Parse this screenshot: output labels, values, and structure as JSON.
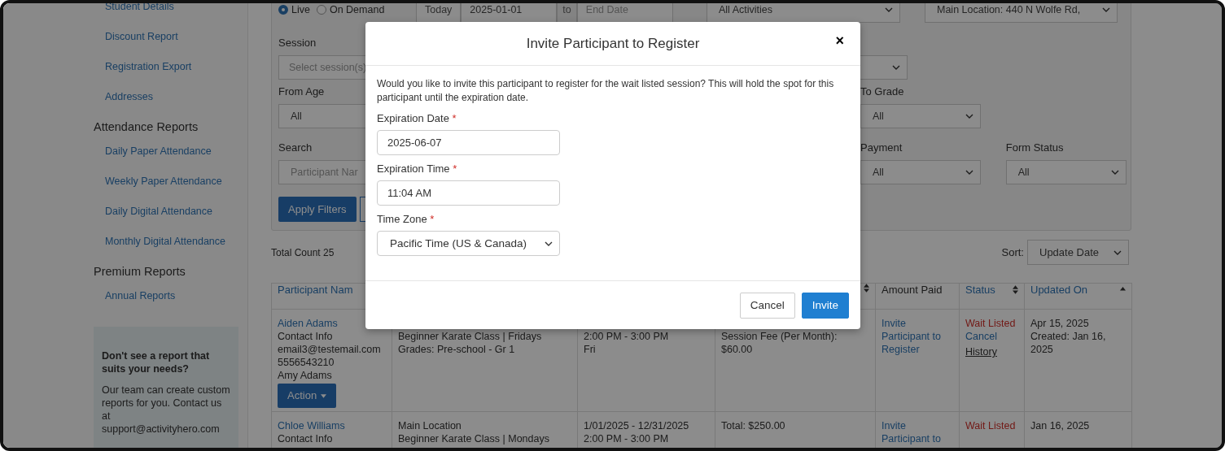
{
  "sidebar": {
    "items": [
      {
        "kind": "link",
        "label": "Student Details"
      },
      {
        "kind": "link",
        "label": "Discount Report"
      },
      {
        "kind": "link",
        "label": "Registration Export"
      },
      {
        "kind": "link",
        "label": "Addresses"
      },
      {
        "kind": "heading",
        "label": "Attendance Reports"
      },
      {
        "kind": "link",
        "label": "Daily Paper Attendance"
      },
      {
        "kind": "link",
        "label": "Weekly Paper Attendance"
      },
      {
        "kind": "link",
        "label": "Daily Digital Attendance"
      },
      {
        "kind": "link",
        "label": "Monthly Digital Attendance"
      },
      {
        "kind": "heading",
        "label": "Premium Reports"
      },
      {
        "kind": "link",
        "label": "Annual Reports"
      }
    ],
    "promo": {
      "title": "Don't see a report that suits your needs?",
      "text": "Our team can create custom reports for you. Contact us at support@activityhero.com"
    }
  },
  "filters": {
    "mode_options": [
      {
        "label": "Live",
        "selected": true
      },
      {
        "label": "On Demand",
        "selected": false
      }
    ],
    "date_range": {
      "preset": "Today",
      "start": "2025-01-01",
      "separator": "to",
      "end_placeholder": "End Date"
    },
    "activity": "All Activities",
    "location": "Main Location: 440 N Wolfe Rd,",
    "session": {
      "label": "Session",
      "placeholder": "Select session(s)"
    },
    "from_age": {
      "label": "From Age",
      "value": "All"
    },
    "to_grade": {
      "label": "To Grade",
      "value": "All"
    },
    "search": {
      "label": "Search",
      "placeholder": "Participant Nar"
    },
    "payment": {
      "label": "Payment",
      "value": "All"
    },
    "form_status": {
      "label": "Form Status",
      "value": "All"
    },
    "apply_button": "Apply Filters"
  },
  "total_count": "Total Count 25",
  "sort": {
    "label": "Sort:",
    "value": "Update Date"
  },
  "table": {
    "columns": [
      {
        "label": "Participant Nam"
      },
      {},
      {},
      {
        "sortable": true
      },
      {
        "label": "Amount Paid",
        "sortable": false
      },
      {
        "label": "Status",
        "sortable": true
      },
      {
        "label": "Updated On",
        "sorted": true
      }
    ],
    "rows": [
      {
        "cells": [
          {
            "parts": [
              {
                "kind": "link",
                "text": "Aiden Adams"
              },
              {
                "kind": "text",
                "text": "Contact Info"
              },
              {
                "kind": "text",
                "text": "email3@testemail.com"
              },
              {
                "kind": "text",
                "text": "5556543210"
              },
              {
                "kind": "text",
                "text": "Amy Adams"
              },
              {
                "kind": "button",
                "text": "Action"
              }
            ]
          },
          {
            "first_line_hidden": true,
            "parts": [
              {
                "kind": "text",
                "text": "Beginner Karate Class | Fridays"
              },
              {
                "kind": "text",
                "text": "Grades: Pre-school - Gr 1"
              }
            ]
          },
          {
            "first_line_hidden": true,
            "parts": [
              {
                "kind": "text",
                "text": "2:00 PM - 3:00 PM"
              },
              {
                "kind": "text",
                "text": "Fri"
              }
            ]
          },
          {
            "first_line_hidden": true,
            "parts": [
              {
                "kind": "text",
                "text": "Session Fee (Per Month):"
              },
              {
                "kind": "text",
                "text": "$60.00"
              }
            ]
          },
          {
            "parts": [
              {
                "kind": "link",
                "text": "Invite Participant to Register"
              }
            ]
          },
          {
            "parts": [
              {
                "kind": "alert",
                "text": "Wait Listed"
              },
              {
                "kind": "link",
                "text": "Cancel"
              },
              {
                "kind": "underline",
                "text": "History"
              }
            ]
          },
          {
            "parts": [
              {
                "kind": "text",
                "text": "Apr 15, 2025"
              },
              {
                "kind": "text",
                "text": "Created: Jan 16, 2025"
              }
            ]
          }
        ]
      },
      {
        "cells": [
          {
            "parts": [
              {
                "kind": "link",
                "text": "Chloe Williams"
              },
              {
                "kind": "text",
                "text": "Contact Info"
              }
            ]
          },
          {
            "parts": [
              {
                "kind": "text",
                "text": "Main Location"
              },
              {
                "kind": "text",
                "text": "Beginner Karate Class | Mondays"
              }
            ]
          },
          {
            "parts": [
              {
                "kind": "text",
                "text": "1/01/2025 - 12/31/2025"
              },
              {
                "kind": "text",
                "text": "2:00 PM - 3:00 PM"
              }
            ]
          },
          {
            "parts": [
              {
                "kind": "text",
                "text": "Total: $250.00"
              }
            ]
          },
          {
            "parts": [
              {
                "kind": "link",
                "text": "Invite Participant to"
              }
            ]
          },
          {
            "parts": [
              {
                "kind": "alert",
                "text": "Wait Listed"
              }
            ]
          },
          {
            "parts": [
              {
                "kind": "text",
                "text": "Jan 16, 2025"
              }
            ]
          }
        ]
      }
    ]
  },
  "modal": {
    "title": "Invite Participant to Register",
    "close": "×",
    "message": "Would you like to invite this participant to register for the wait listed session? This will hold the spot for this participant until the expiration date.",
    "fields": [
      {
        "kind": "input",
        "label": "Expiration Date",
        "required_mark": "*",
        "value": "2025-06-07"
      },
      {
        "kind": "input",
        "label": "Expiration Time",
        "required_mark": "*",
        "value": "11:04 AM"
      },
      {
        "kind": "select",
        "label": "Time Zone",
        "required_mark": "*",
        "value": "Pacific Time (US & Canada)"
      }
    ],
    "buttons": [
      {
        "kind": "secondary",
        "label": "Cancel"
      },
      {
        "kind": "primary",
        "label": "Invite"
      }
    ]
  }
}
